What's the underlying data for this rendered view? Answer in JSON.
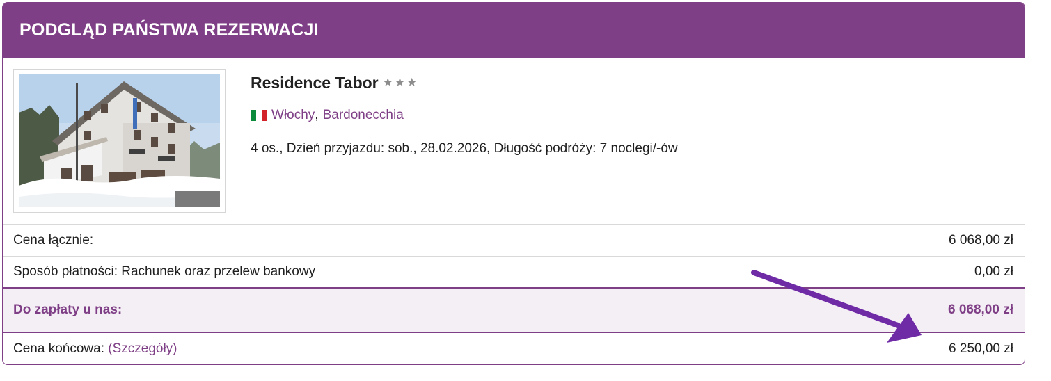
{
  "header": {
    "title": "PODGLĄD PAŃSTWA REZERWACJI"
  },
  "hotel": {
    "name": "Residence Tabor",
    "stars": "★★★",
    "country": "Włochy",
    "city": "Bardonecchia",
    "details": "4 os., Dzień przyjazdu: sob., 28.02.2026, Długość podróży: 7 noclegi/-ów"
  },
  "summary": {
    "total_label": "Cena łącznie:",
    "total_value": "6 068,00 zł",
    "payment_label": "Sposób płatności: Rachunek oraz przelew bankowy",
    "payment_value": "0,00 zł",
    "due_label": "Do zapłaty u nas:",
    "due_value": "6 068,00 zł",
    "final_label": "Cena końcowa:",
    "final_link": "(Szczegóły)",
    "final_value": "6 250,00 zł"
  },
  "colors": {
    "brand": "#7f3f86",
    "due_background": "#f4eef5",
    "annotation_arrow": "#6f2aa6"
  },
  "icons": {
    "flag": "italy-flag-icon",
    "arrow": "annotation-arrow-icon"
  }
}
